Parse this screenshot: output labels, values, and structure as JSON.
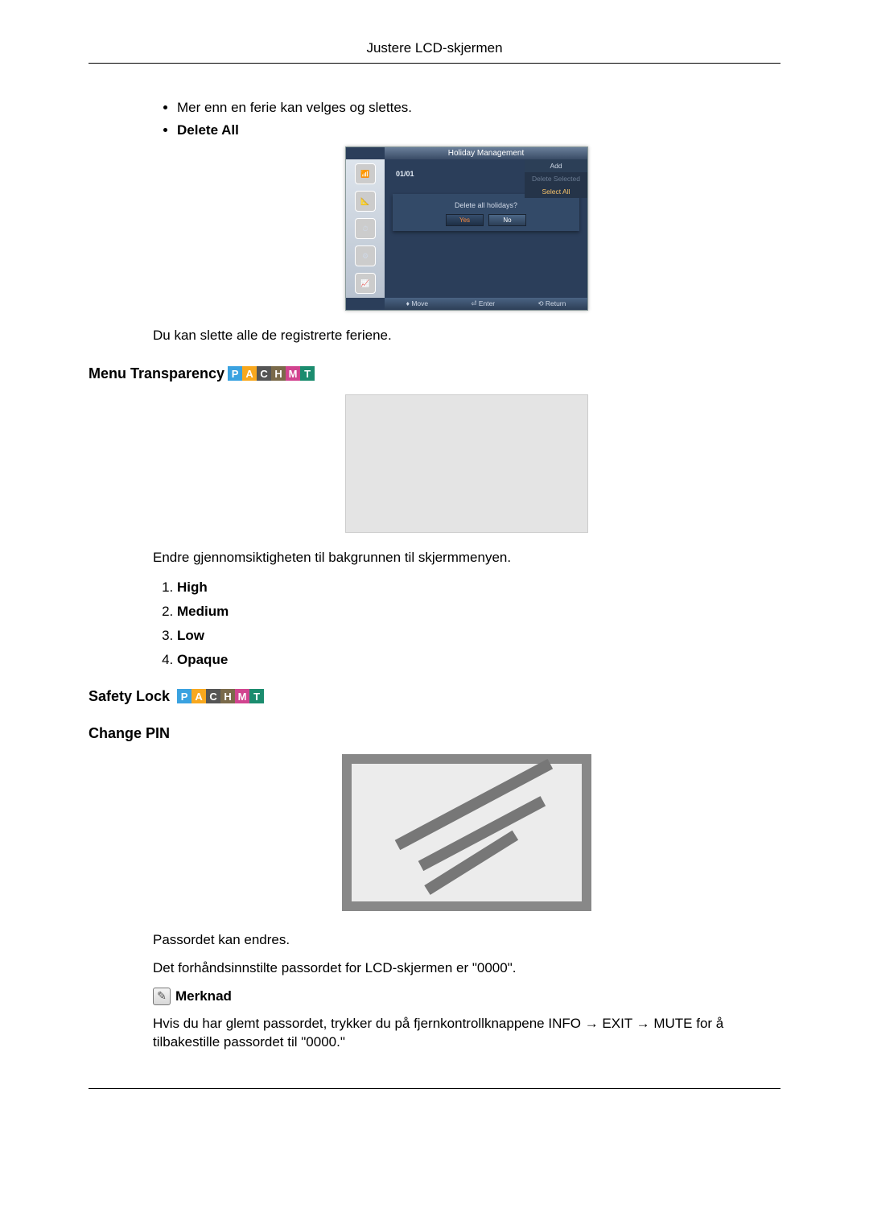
{
  "header": {
    "title": "Justere LCD-skjermen"
  },
  "section1": {
    "bullet1": "Mer enn en ferie kan velges og slettes.",
    "delete_all_label": "Delete All",
    "desc": "Du kan slette alle de registrerte feriene.",
    "osd": {
      "title": "Holiday Management",
      "date": "01/01",
      "add": "Add",
      "del_selected": "Delete Selected",
      "sel": "Select All",
      "dialog_q": "Delete all holidays?",
      "yes": "Yes",
      "no": "No",
      "foot_move": "Move",
      "foot_enter": "Enter",
      "foot_return": "Return"
    }
  },
  "menu_transparency": {
    "heading": "Menu Transparency",
    "desc": "Endre gjennomsiktigheten til bakgrunnen til skjermmenyen.",
    "items": {
      "0": "High",
      "1": "Medium",
      "2": "Low",
      "3": "Opaque"
    }
  },
  "safety_lock": {
    "heading": "Safety Lock"
  },
  "change_pin": {
    "heading": "Change PIN",
    "p1": "Passordet kan endres.",
    "p2": "Det forhåndsinnstilte passordet for LCD-skjermen er \"0000\".",
    "note_label": "Merknad",
    "note_body": "Hvis du har glemt passordet, trykker du på fjernkontrollknappene INFO → EXIT → MUTE for å tilbakestille passordet til \"0000.\""
  },
  "pachmt": [
    "P",
    "A",
    "C",
    "H",
    "M",
    "T"
  ]
}
